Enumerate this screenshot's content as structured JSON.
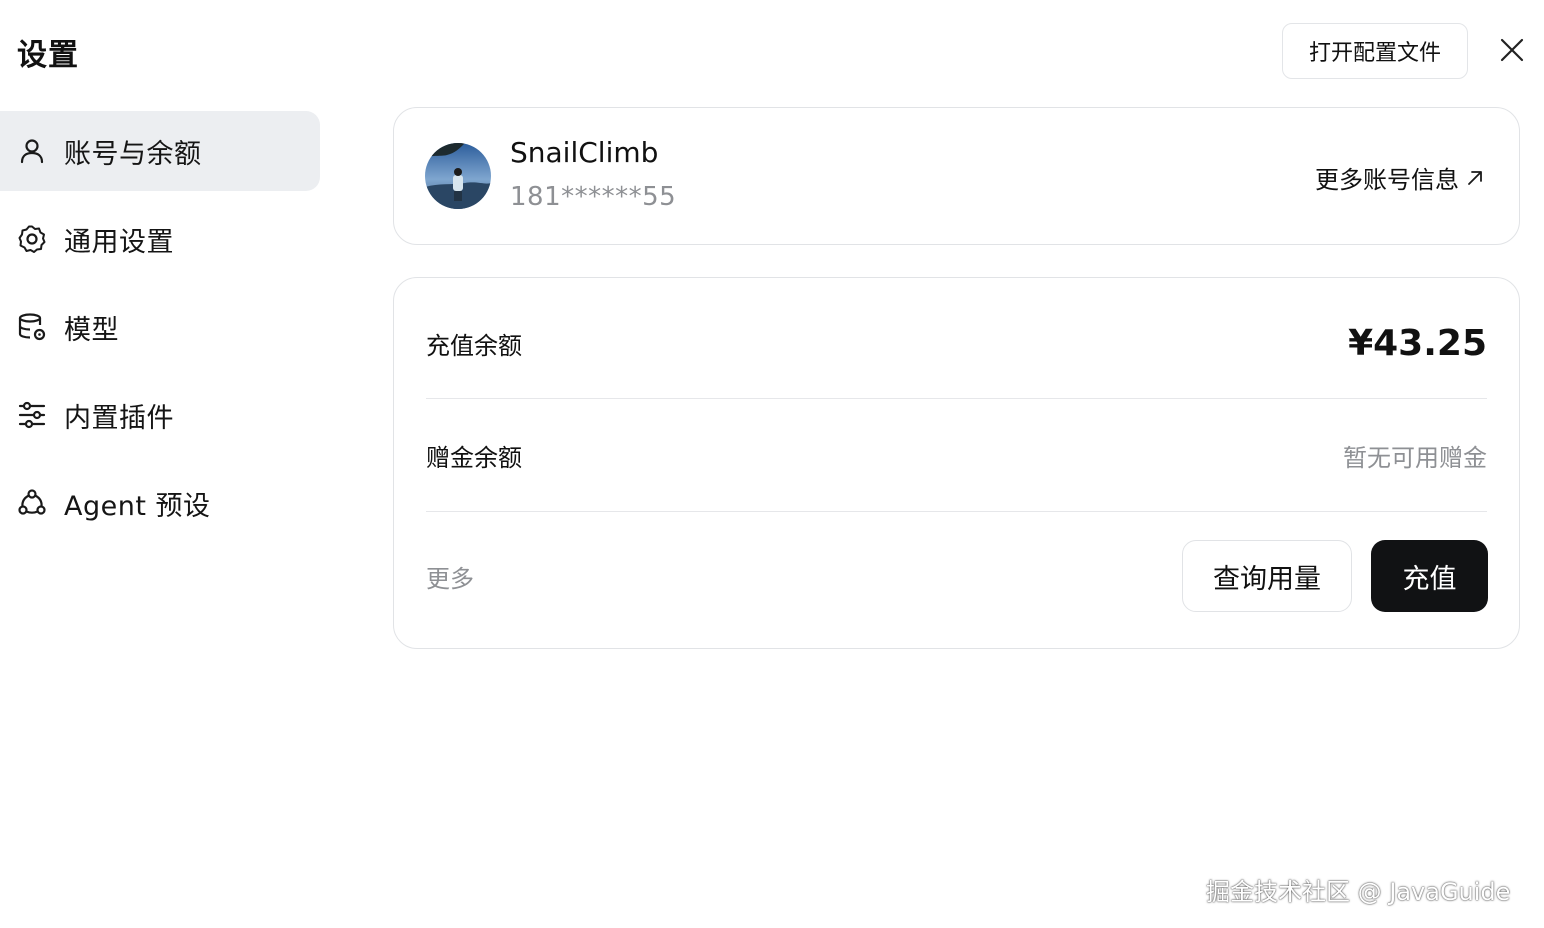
{
  "header": {
    "title": "设置",
    "open_config_label": "打开配置文件",
    "close_icon": "close-icon"
  },
  "sidebar": {
    "items": [
      {
        "label": "账号与余额",
        "icon": "user-icon",
        "active": true
      },
      {
        "label": "通用设置",
        "icon": "gear-icon",
        "active": false
      },
      {
        "label": "模型",
        "icon": "database-settings-icon",
        "active": false
      },
      {
        "label": "内置插件",
        "icon": "sliders-icon",
        "active": false
      },
      {
        "label": "Agent 预设",
        "icon": "agent-nodes-icon",
        "active": false
      }
    ]
  },
  "account": {
    "username": "SnailClimb",
    "phone": "181******55",
    "more_info_label": "更多账号信息"
  },
  "balance": {
    "recharge_label": "充值余额",
    "recharge_amount": "¥43.25",
    "bonus_label": "赠金余额",
    "bonus_value": "暂无可用赠金",
    "more_label": "更多",
    "query_usage_label": "查询用量",
    "recharge_button_label": "充值"
  },
  "watermark": "掘金技术社区 @ JavaGuide",
  "colors": {
    "active_nav_bg": "#eceef1",
    "primary_button_bg": "#111214",
    "muted_text": "#8e9094",
    "border": "#e1e3e6"
  }
}
